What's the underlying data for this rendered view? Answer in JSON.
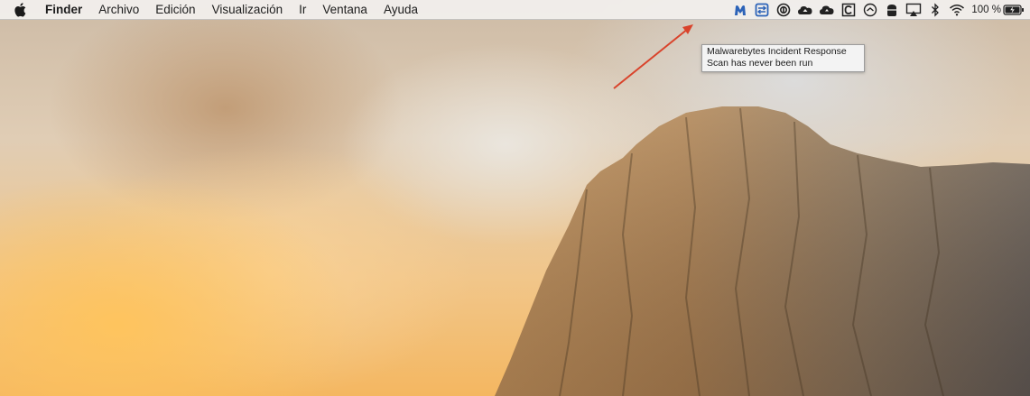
{
  "menubar": {
    "apple_icon": "apple-logo",
    "app_name": "Finder",
    "items": [
      "Archivo",
      "Edición",
      "Visualización",
      "Ir",
      "Ventana",
      "Ayuda"
    ]
  },
  "status_bar": {
    "icons": [
      "malwarebytes-icon",
      "screen-share-icon",
      "circle-badge-icon",
      "cloud-upload-icon",
      "cloud-icon",
      "c-box-icon",
      "sync-icon",
      "stack-icon",
      "airplay-icon",
      "bluetooth-icon",
      "wifi-icon"
    ],
    "battery_percent_label": "100 %",
    "battery_level": 1.0,
    "accent": "#2c63b8"
  },
  "tooltip": {
    "line1": "Malwarebytes Incident Response",
    "line2": "Scan has never been run"
  },
  "annotation": {
    "arrow_color": "#d9432b"
  }
}
